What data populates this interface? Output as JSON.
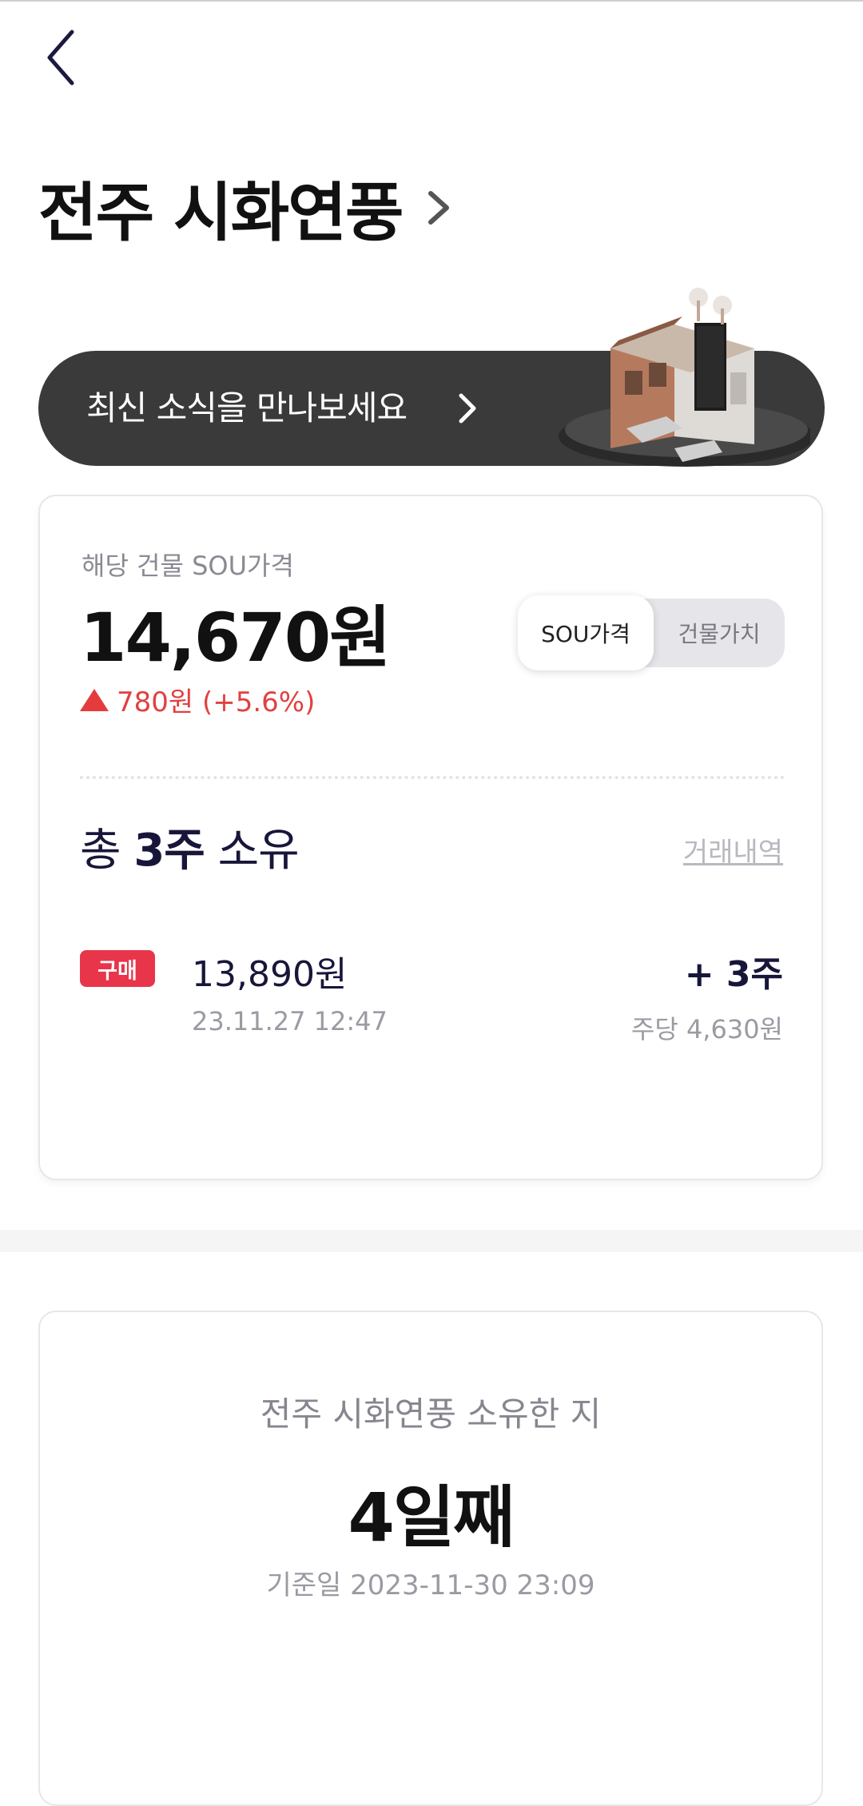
{
  "header": {
    "back_icon": "chevron-left-icon",
    "title": "전주 시화연풍",
    "title_icon": "chevron-right-icon"
  },
  "news_banner": {
    "label": "최신 소식을 만나보세요",
    "icon": "chevron-right-icon",
    "illustration": "building-illustration"
  },
  "price_card": {
    "label": "해당 건물 SOU가격",
    "price": "14,670원",
    "change": "780원 (+5.6%)",
    "change_color": "#e43c3c",
    "toggle": {
      "selected": "SOU가격",
      "other": "건물가치"
    }
  },
  "holdings": {
    "prefix": "총 ",
    "count": "3주",
    "suffix": " 소유",
    "history_link": "거래내역",
    "transactions": [
      {
        "badge": "구매",
        "amount": "13,890원",
        "datetime": "23.11.27 12:47",
        "shares": "+ 3주",
        "per_share": "주당 4,630원"
      }
    ]
  },
  "ownership": {
    "label": "전주 시화연풍 소유한 지",
    "days": "4일째",
    "as_of": "기준일 2023-11-30 23:09"
  }
}
